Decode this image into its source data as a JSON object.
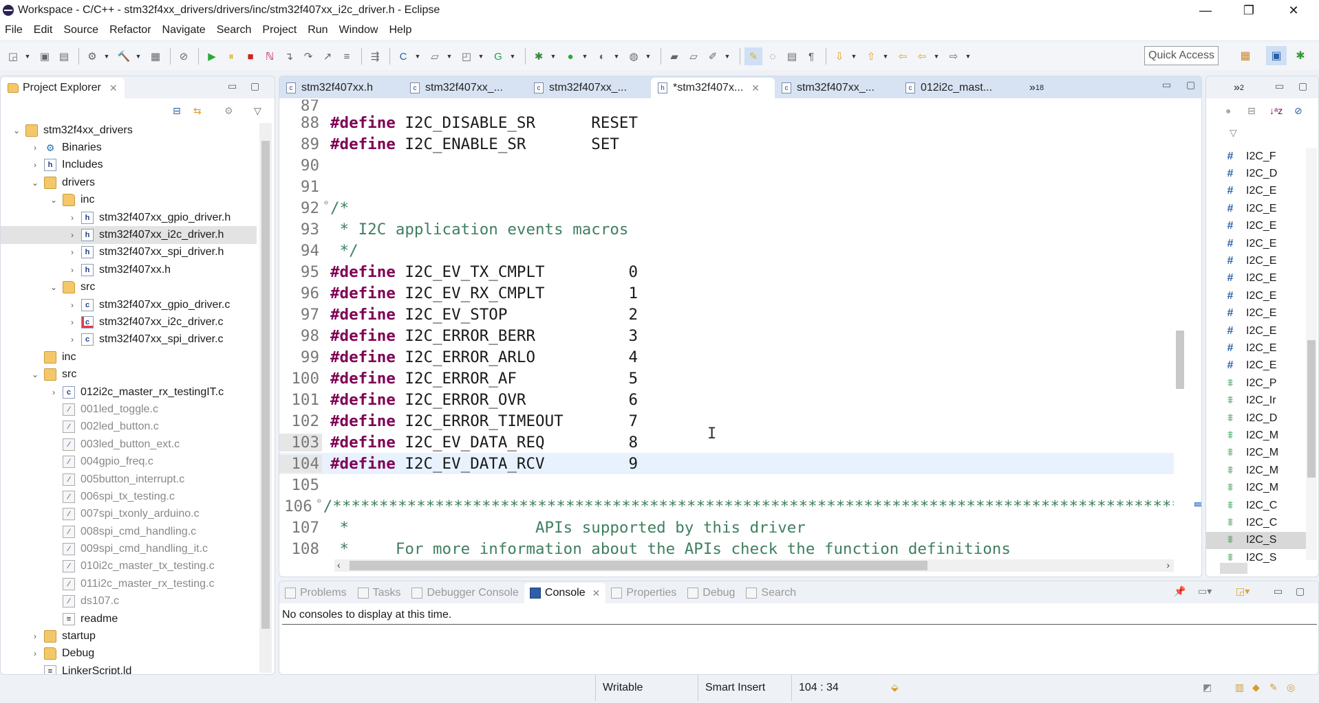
{
  "window": {
    "title": "Workspace - C/C++ - stm32f4xx_drivers/drivers/inc/stm32f407xx_i2c_driver.h - Eclipse",
    "minimize": "—",
    "restore": "❐",
    "close": "✕"
  },
  "menu": [
    "File",
    "Edit",
    "Source",
    "Refactor",
    "Navigate",
    "Search",
    "Project",
    "Run",
    "Window",
    "Help"
  ],
  "toolbar": {
    "quick_access": "Quick Access",
    "icons": [
      "new-icon",
      "save-icon",
      "save-all-icon",
      "build-config-icon",
      "build-icon",
      "binary-icon",
      "skip-breakpoints-icon",
      "resume-icon",
      "suspend-icon",
      "terminate-icon",
      "disconnect-icon",
      "step-into-icon",
      "step-over-icon",
      "step-return-icon",
      "instruction-step-icon",
      "use-step-filters-icon",
      "new-class-icon",
      "new-folder-icon",
      "new-file-icon",
      "new-project-icon",
      "debug-icon",
      "run-icon",
      "coverage-icon",
      "external-tools-icon",
      "open-type-icon",
      "open-element-icon",
      "search-icon",
      "toggle-mark-occurrences-icon",
      "block-selection-icon",
      "word-wrap-icon",
      "show-whitespace-icon",
      "next-annotation-icon",
      "previous-annotation-icon",
      "last-edit-icon",
      "back-icon",
      "forward-icon"
    ]
  },
  "explorer": {
    "title": "Project Explorer",
    "tree": [
      {
        "label": "stm32f4xx_drivers",
        "depth": 0,
        "twisty": "open",
        "icon": "cfolder"
      },
      {
        "label": "Binaries",
        "depth": 1,
        "twisty": "closed",
        "icon": "bin"
      },
      {
        "label": "Includes",
        "depth": 1,
        "twisty": "closed",
        "icon": "hfile"
      },
      {
        "label": "drivers",
        "depth": 1,
        "twisty": "open",
        "icon": "cfolder"
      },
      {
        "label": "inc",
        "depth": 2,
        "twisty": "open",
        "icon": "folder"
      },
      {
        "label": "stm32f407xx_gpio_driver.h",
        "depth": 3,
        "twisty": "closed",
        "icon": "hfile"
      },
      {
        "label": "stm32f407xx_i2c_driver.h",
        "depth": 3,
        "twisty": "closed",
        "icon": "hfile",
        "selected": true
      },
      {
        "label": "stm32f407xx_spi_driver.h",
        "depth": 3,
        "twisty": "closed",
        "icon": "hfile"
      },
      {
        "label": "stm32f407xx.h",
        "depth": 3,
        "twisty": "closed",
        "icon": "hfile"
      },
      {
        "label": "src",
        "depth": 2,
        "twisty": "open",
        "icon": "folder"
      },
      {
        "label": "stm32f407xx_gpio_driver.c",
        "depth": 3,
        "twisty": "closed",
        "icon": "cfile"
      },
      {
        "label": "stm32f407xx_i2c_driver.c",
        "depth": 3,
        "twisty": "closed",
        "icon": "xfile"
      },
      {
        "label": "stm32f407xx_spi_driver.c",
        "depth": 3,
        "twisty": "closed",
        "icon": "cfile"
      },
      {
        "label": "inc",
        "depth": 1,
        "twisty": "none",
        "icon": "cfolder"
      },
      {
        "label": "src",
        "depth": 1,
        "twisty": "open",
        "icon": "cfolder"
      },
      {
        "label": "012i2c_master_rx_testingIT.c",
        "depth": 2,
        "twisty": "closed",
        "icon": "cfile"
      },
      {
        "label": "001led_toggle.c",
        "depth": 2,
        "twisty": "none",
        "icon": "excl",
        "grey": true
      },
      {
        "label": "002led_button.c",
        "depth": 2,
        "twisty": "none",
        "icon": "excl",
        "grey": true
      },
      {
        "label": "003led_button_ext.c",
        "depth": 2,
        "twisty": "none",
        "icon": "excl",
        "grey": true
      },
      {
        "label": "004gpio_freq.c",
        "depth": 2,
        "twisty": "none",
        "icon": "excl",
        "grey": true
      },
      {
        "label": "005button_interrupt.c",
        "depth": 2,
        "twisty": "none",
        "icon": "excl",
        "grey": true
      },
      {
        "label": "006spi_tx_testing.c",
        "depth": 2,
        "twisty": "none",
        "icon": "excl",
        "grey": true
      },
      {
        "label": "007spi_txonly_arduino.c",
        "depth": 2,
        "twisty": "none",
        "icon": "excl",
        "grey": true
      },
      {
        "label": "008spi_cmd_handling.c",
        "depth": 2,
        "twisty": "none",
        "icon": "excl",
        "grey": true
      },
      {
        "label": "009spi_cmd_handling_it.c",
        "depth": 2,
        "twisty": "none",
        "icon": "excl",
        "grey": true
      },
      {
        "label": "010i2c_master_tx_testing.c",
        "depth": 2,
        "twisty": "none",
        "icon": "excl",
        "grey": true
      },
      {
        "label": "011i2c_master_rx_testing.c",
        "depth": 2,
        "twisty": "none",
        "icon": "excl",
        "grey": true
      },
      {
        "label": "ds107.c",
        "depth": 2,
        "twisty": "none",
        "icon": "excl",
        "grey": true
      },
      {
        "label": "readme",
        "depth": 2,
        "twisty": "none",
        "icon": "doc"
      },
      {
        "label": "startup",
        "depth": 1,
        "twisty": "closed",
        "icon": "cfolder"
      },
      {
        "label": "Debug",
        "depth": 1,
        "twisty": "closed",
        "icon": "folder"
      },
      {
        "label": "LinkerScript.ld",
        "depth": 1,
        "twisty": "none",
        "icon": "doc"
      }
    ]
  },
  "editor": {
    "tabs": [
      {
        "label": "stm32f407xx.h",
        "icon": "c",
        "active": false
      },
      {
        "label": "stm32f407xx_...",
        "icon": "c",
        "active": false
      },
      {
        "label": "stm32f407xx_...",
        "icon": "c",
        "active": false
      },
      {
        "label": "*stm32f407x...",
        "icon": "h",
        "active": true
      },
      {
        "label": "stm32f407xx_...",
        "icon": "c",
        "active": false
      },
      {
        "label": "012i2c_mast...",
        "icon": "c",
        "active": false
      }
    ],
    "overflow": "»",
    "overflow_count": "18",
    "lines": [
      {
        "n": "87",
        "parts": []
      },
      {
        "n": "88",
        "parts": [
          [
            "kw",
            "#define"
          ],
          [
            "tx",
            " I2C_DISABLE_SR      RESET"
          ]
        ]
      },
      {
        "n": "89",
        "parts": [
          [
            "kw",
            "#define"
          ],
          [
            "tx",
            " I2C_ENABLE_SR       SET"
          ]
        ]
      },
      {
        "n": "90",
        "parts": []
      },
      {
        "n": "91",
        "parts": []
      },
      {
        "n": "92",
        "fold": true,
        "parts": [
          [
            "cm",
            "/*"
          ]
        ]
      },
      {
        "n": "93",
        "parts": [
          [
            "cm",
            " * I2C application events macros"
          ]
        ]
      },
      {
        "n": "94",
        "parts": [
          [
            "cm",
            " */"
          ]
        ]
      },
      {
        "n": "95",
        "parts": [
          [
            "kw",
            "#define"
          ],
          [
            "tx",
            " I2C_EV_TX_CMPLT         0"
          ]
        ]
      },
      {
        "n": "96",
        "parts": [
          [
            "kw",
            "#define"
          ],
          [
            "tx",
            " I2C_EV_RX_CMPLT         1"
          ]
        ]
      },
      {
        "n": "97",
        "parts": [
          [
            "kw",
            "#define"
          ],
          [
            "tx",
            " I2C_EV_STOP             2"
          ]
        ]
      },
      {
        "n": "98",
        "parts": [
          [
            "kw",
            "#define"
          ],
          [
            "tx",
            " I2C_ERROR_BERR          3"
          ]
        ]
      },
      {
        "n": "99",
        "parts": [
          [
            "kw",
            "#define"
          ],
          [
            "tx",
            " I2C_ERROR_ARLO          4"
          ]
        ]
      },
      {
        "n": "100",
        "parts": [
          [
            "kw",
            "#define"
          ],
          [
            "tx",
            " I2C_ERROR_AF            5"
          ]
        ]
      },
      {
        "n": "101",
        "parts": [
          [
            "kw",
            "#define"
          ],
          [
            "tx",
            " I2C_ERROR_OVR           6"
          ]
        ]
      },
      {
        "n": "102",
        "parts": [
          [
            "kw",
            "#define"
          ],
          [
            "tx",
            " I2C_ERROR_TIMEOUT       7"
          ]
        ]
      },
      {
        "n": "103",
        "mark": true,
        "parts": [
          [
            "kw",
            "#define"
          ],
          [
            "tx",
            " I2C_EV_DATA_REQ         8"
          ]
        ]
      },
      {
        "n": "104",
        "mark": true,
        "current": true,
        "parts": [
          [
            "kw",
            "#define"
          ],
          [
            "tx",
            " I2C_EV_DATA_RCV         9"
          ]
        ]
      },
      {
        "n": "105",
        "parts": []
      },
      {
        "n": "106",
        "fold": true,
        "parts": [
          [
            "cm",
            "/*******************************************************************************************"
          ]
        ]
      },
      {
        "n": "107",
        "parts": [
          [
            "cm",
            " *                    APIs supported by this driver"
          ]
        ]
      },
      {
        "n": "108",
        "parts": [
          [
            "cm",
            " *     For more information about the APIs check the function definitions"
          ]
        ]
      }
    ]
  },
  "outline": {
    "overflow": "»",
    "overflow_count": "2",
    "items": [
      {
        "kind": "macro",
        "label": "I2C_F"
      },
      {
        "kind": "macro",
        "label": "I2C_D"
      },
      {
        "kind": "macro",
        "label": "I2C_E"
      },
      {
        "kind": "macro",
        "label": "I2C_E"
      },
      {
        "kind": "macro",
        "label": "I2C_E"
      },
      {
        "kind": "macro",
        "label": "I2C_E"
      },
      {
        "kind": "macro",
        "label": "I2C_E"
      },
      {
        "kind": "macro",
        "label": "I2C_E"
      },
      {
        "kind": "macro",
        "label": "I2C_E"
      },
      {
        "kind": "macro",
        "label": "I2C_E"
      },
      {
        "kind": "macro",
        "label": "I2C_E"
      },
      {
        "kind": "macro",
        "label": "I2C_E"
      },
      {
        "kind": "macro",
        "label": "I2C_E"
      },
      {
        "kind": "func",
        "label": "I2C_P"
      },
      {
        "kind": "func",
        "label": "I2C_Ir"
      },
      {
        "kind": "func",
        "label": "I2C_D"
      },
      {
        "kind": "func",
        "label": "I2C_M"
      },
      {
        "kind": "func",
        "label": "I2C_M"
      },
      {
        "kind": "func",
        "label": "I2C_M"
      },
      {
        "kind": "func",
        "label": "I2C_M"
      },
      {
        "kind": "func",
        "label": "I2C_C"
      },
      {
        "kind": "func",
        "label": "I2C_C"
      },
      {
        "kind": "func",
        "label": "I2C_S",
        "selected": true
      },
      {
        "kind": "func",
        "label": "I2C_S"
      }
    ]
  },
  "console": {
    "tabs": [
      {
        "label": "Problems",
        "active": false
      },
      {
        "label": "Tasks",
        "active": false
      },
      {
        "label": "Debugger Console",
        "active": false
      },
      {
        "label": "Console",
        "active": true
      },
      {
        "label": "Properties",
        "active": false
      },
      {
        "label": "Debug",
        "active": false
      },
      {
        "label": "Search",
        "active": false
      }
    ],
    "message": "No consoles to display at this time."
  },
  "status": {
    "writable": "Writable",
    "insert_mode": "Smart Insert",
    "position": "104 : 34"
  }
}
